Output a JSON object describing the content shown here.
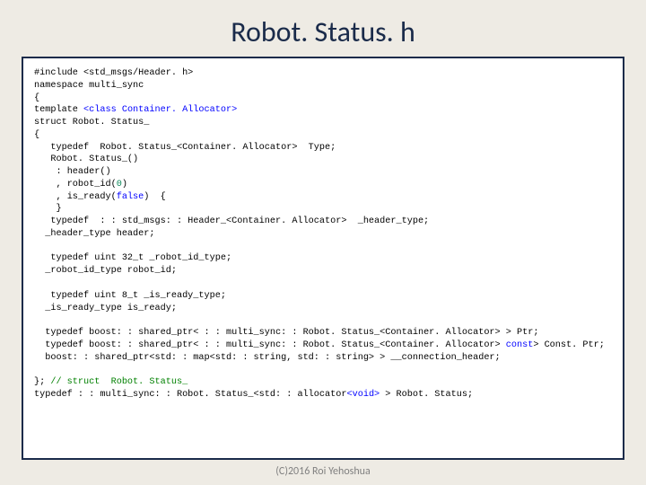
{
  "title": "Robot. Status. h",
  "footer": "(C)2016 Roi Yehoshua",
  "code": {
    "l1a": "#include <std_msgs/Header. h>",
    "l2a": "namespace multi_sync",
    "l3a": "{",
    "l4a": "template ",
    "l4b": "<class Container. Allocator>",
    "l5a": "struct Robot. Status_",
    "l6a": "{",
    "l7a": "   typedef  Robot. Status_<Container. Allocator>  Type;",
    "l8a": "   Robot. Status_()",
    "l9a": "    : header()",
    "l10a": "    , robot_id(",
    "l10b": "0",
    "l10c": ")",
    "l11a": "    , is_ready(",
    "l11b": "false",
    "l11c": ")  {",
    "l12a": "    }",
    "l13a": "   typedef  : : std_msgs: : Header_<Container. Allocator>  _header_type;",
    "l14a": "  _header_type header;",
    "blank": " ",
    "l15a": "   typedef uint 32_t _robot_id_type;",
    "l16a": "  _robot_id_type robot_id;",
    "l17a": "   typedef uint 8_t _is_ready_type;",
    "l18a": "  _is_ready_type is_ready;",
    "l19a": "  typedef boost: : shared_ptr< : : multi_sync: : Robot. Status_<Container. Allocator> > Ptr;",
    "l20a": "  typedef boost: : shared_ptr< : : multi_sync: : Robot. Status_<Container. Allocator>",
    "l20b": " const",
    "l20c": "> Const. Ptr;",
    "l21a": "  boost: : shared_ptr<std: : map<std: : string, std: : string> > __connection_header;",
    "l22a": "}; ",
    "l22b": "// struct  Robot. Status_",
    "l23a": "typedef : : multi_sync: : Robot. Status_<std: : allocator",
    "l23b": "<void>",
    "l23c": " > Robot. Status;"
  }
}
